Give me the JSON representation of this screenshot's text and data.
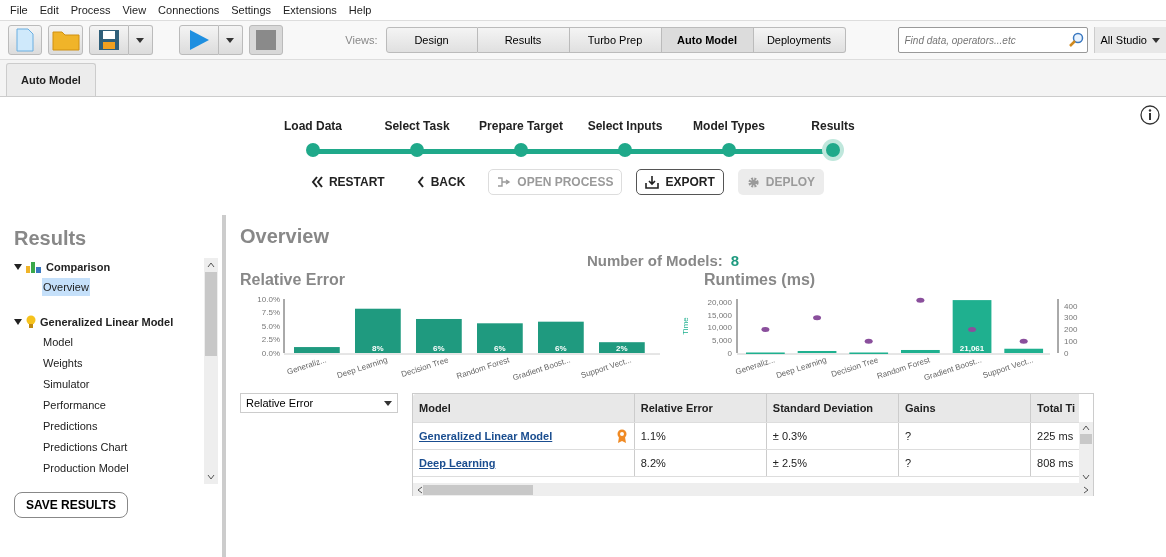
{
  "menu": [
    "File",
    "Edit",
    "Process",
    "View",
    "Connections",
    "Settings",
    "Extensions",
    "Help"
  ],
  "views_label": "Views:",
  "views": [
    {
      "label": "Design",
      "selected": false
    },
    {
      "label": "Results",
      "selected": false
    },
    {
      "label": "Turbo Prep",
      "selected": false
    },
    {
      "label": "Auto Model",
      "selected": true
    },
    {
      "label": "Deployments",
      "selected": false
    }
  ],
  "search": {
    "placeholder": "Find data, operators...etc"
  },
  "scope": "All Studio",
  "doc_tab": "Auto Model",
  "steps": [
    {
      "label": "Load Data",
      "selected": false
    },
    {
      "label": "Select Task",
      "selected": false
    },
    {
      "label": "Prepare Target",
      "selected": false
    },
    {
      "label": "Select Inputs",
      "selected": false
    },
    {
      "label": "Model Types",
      "selected": false
    },
    {
      "label": "Results",
      "selected": true
    }
  ],
  "actions": [
    {
      "kind": "restart",
      "label": "RESTART",
      "disabled": false
    },
    {
      "kind": "back",
      "label": "BACK",
      "disabled": false
    },
    {
      "kind": "open",
      "label": "OPEN PROCESS",
      "disabled": true
    },
    {
      "kind": "export",
      "label": "EXPORT",
      "disabled": false
    },
    {
      "kind": "deploy",
      "label": "DEPLOY",
      "disabled": true
    }
  ],
  "sidebar": {
    "title": "Results",
    "tree": [
      {
        "label": "Comparison",
        "kind": "comparison",
        "expanded": true,
        "children": [
          {
            "label": "Overview",
            "selected": true
          }
        ]
      },
      {
        "label": "Generalized Linear Model",
        "kind": "model",
        "expanded": true,
        "children": [
          {
            "label": "Model",
            "selected": false
          },
          {
            "label": "Weights",
            "selected": false
          },
          {
            "label": "Simulator",
            "selected": false
          },
          {
            "label": "Performance",
            "selected": false
          },
          {
            "label": "Predictions",
            "selected": false
          },
          {
            "label": "Predictions Chart",
            "selected": false
          },
          {
            "label": "Production Model",
            "selected": false
          }
        ]
      }
    ],
    "save": "SAVE RESULTS"
  },
  "overview": {
    "title": "Overview",
    "count_label": "Number of Models:",
    "count": "8",
    "error_chart": {
      "title": "Relative Error",
      "chart_data": {
        "type": "bar",
        "categories": [
          "Generaliz...",
          "Deep Learning",
          "Decision Tree",
          "Random Forest",
          "Gradient Boost...",
          "Support Vect..."
        ],
        "series": [
          {
            "color": "#1f9a7f",
            "values": [
              1.1,
              8.2,
              6.3,
              5.5,
              5.8,
              2.0
            ]
          }
        ],
        "ylim": [
          0,
          10
        ],
        "yticks": [
          {
            "value": 0,
            "label": "0.0%"
          },
          {
            "value": 2.5,
            "label": "2.5%"
          },
          {
            "value": 5,
            "label": "5.0%"
          },
          {
            "value": 7.5,
            "label": "7.5%"
          },
          {
            "value": 10,
            "label": "10.0%"
          }
        ],
        "value_labels": [
          null,
          "8%",
          "6%",
          "6%",
          "6%",
          "2%"
        ]
      }
    },
    "runtime_chart": {
      "title": "Runtimes (ms)",
      "chart_data": {
        "type": "bar",
        "categories": [
          "Generaliz...",
          "Deep Learning",
          "Decision Tree",
          "Random Forest",
          "Gradient Boost...",
          "Support Vect..."
        ],
        "ylabel": "Time",
        "series": [
          {
            "color": "#1fb08f",
            "values": [
              200,
              800,
              200,
              1200,
              21061,
              1700
            ]
          },
          {
            "type": "scatter",
            "axis": "y2",
            "color": "#8a4f9c",
            "values": [
              200,
              300,
              100,
              450,
              200,
              100
            ]
          }
        ],
        "ylim": [
          0,
          21500
        ],
        "yticks": [
          {
            "value": 0,
            "label": "0"
          },
          {
            "value": 5000,
            "label": "5,000"
          },
          {
            "value": 10000,
            "label": "10,000"
          },
          {
            "value": 15000,
            "label": "15,000"
          },
          {
            "value": 20000,
            "label": "20,000"
          }
        ],
        "y2ticks": [
          {
            "value": 0,
            "label": "0"
          },
          {
            "value": 100,
            "label": "100"
          },
          {
            "value": 200,
            "label": "200"
          },
          {
            "value": 300,
            "label": "300"
          },
          {
            "value": 400,
            "label": "400"
          }
        ],
        "y2lim": [
          0,
          460
        ],
        "value_labels": [
          null,
          null,
          null,
          null,
          "21,061",
          null
        ]
      }
    },
    "metric_select": "Relative Error",
    "table": {
      "columns": [
        "Model",
        "Relative Error",
        "Standard Deviation",
        "Gains",
        "Total Ti"
      ],
      "rows": [
        {
          "cells": [
            "Generalized Linear Model",
            "1.1%",
            "± 0.3%",
            "?",
            "225 ms"
          ],
          "best": true
        },
        {
          "cells": [
            "Deep Learning",
            "8.2%",
            "± 2.5%",
            "?",
            "808 ms"
          ],
          "best": false
        }
      ]
    }
  }
}
